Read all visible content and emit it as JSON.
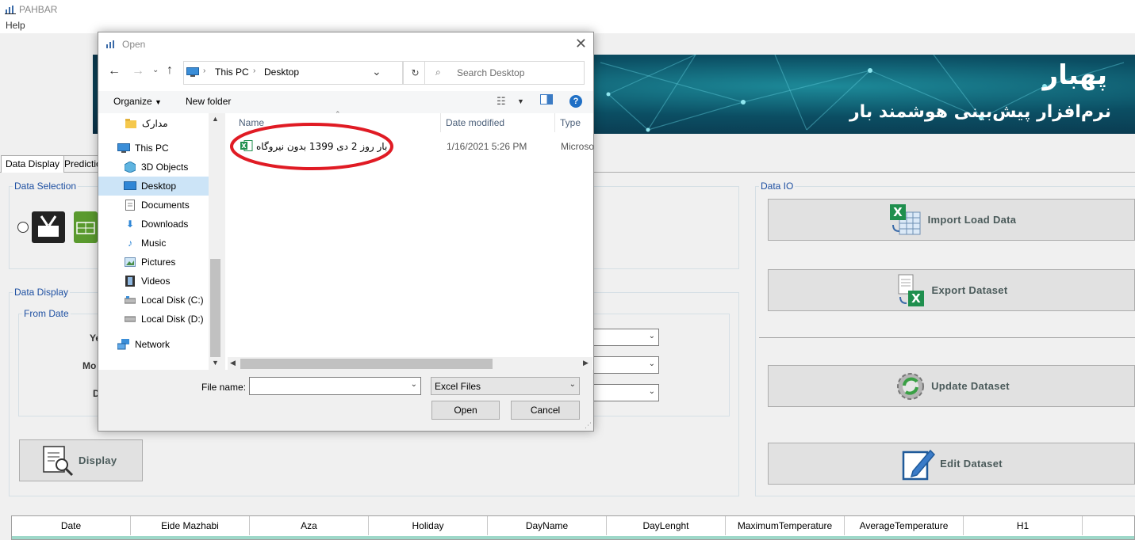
{
  "app": {
    "title": "PAHBAR",
    "menu": [
      "Help"
    ],
    "banner_title": "پهبار",
    "banner_subtitle": "نرم‌افزار پیش‌بینی هوشمند بار"
  },
  "tabs": [
    "Data Display",
    "Predictio"
  ],
  "groups": {
    "data_selection": "Data Selection",
    "data_display": "Data Display",
    "from_date": "From Date",
    "data_io": "Data IO"
  },
  "from_date_labels": [
    "Ye",
    "Mo",
    "D"
  ],
  "buttons": {
    "display": "Display",
    "import": "Import Load Data",
    "export": "Export Dataset",
    "update": "Update Dataset",
    "edit": "Edit Dataset"
  },
  "grid": {
    "columns": [
      "Date",
      "Eide Mazhabi",
      "Aza",
      "Holiday",
      "DayName",
      "DayLenght",
      "MaximumTemperature",
      "AverageTemperature",
      "H1"
    ]
  },
  "dialog": {
    "title": "Open",
    "breadcrumb": [
      "This PC",
      "Desktop"
    ],
    "search_placeholder": "Search Desktop",
    "organize": "Organize",
    "new_folder": "New folder",
    "nav_items": [
      {
        "label": "مدارک",
        "icon": "folder-icon"
      },
      {
        "label": "This PC",
        "icon": "pc-icon"
      },
      {
        "label": "3D Objects",
        "icon": "cube-icon"
      },
      {
        "label": "Desktop",
        "icon": "desktop-icon"
      },
      {
        "label": "Documents",
        "icon": "documents-icon"
      },
      {
        "label": "Downloads",
        "icon": "download-icon"
      },
      {
        "label": "Music",
        "icon": "music-icon"
      },
      {
        "label": "Pictures",
        "icon": "pictures-icon"
      },
      {
        "label": "Videos",
        "icon": "videos-icon"
      },
      {
        "label": "Local Disk (C:)",
        "icon": "disk-icon"
      },
      {
        "label": "Local Disk (D:)",
        "icon": "disk-icon"
      },
      {
        "label": "Network",
        "icon": "network-icon"
      }
    ],
    "columns": [
      "Name",
      "Date modified",
      "Type"
    ],
    "files": [
      {
        "name": "بار روز 2 دی 1399 بدون نیروگاه",
        "date": "1/16/2021 5:26 PM",
        "type": "Microso"
      }
    ],
    "file_name_label": "File name:",
    "file_name_value": "",
    "file_type": "Excel Files",
    "open": "Open",
    "cancel": "Cancel"
  }
}
